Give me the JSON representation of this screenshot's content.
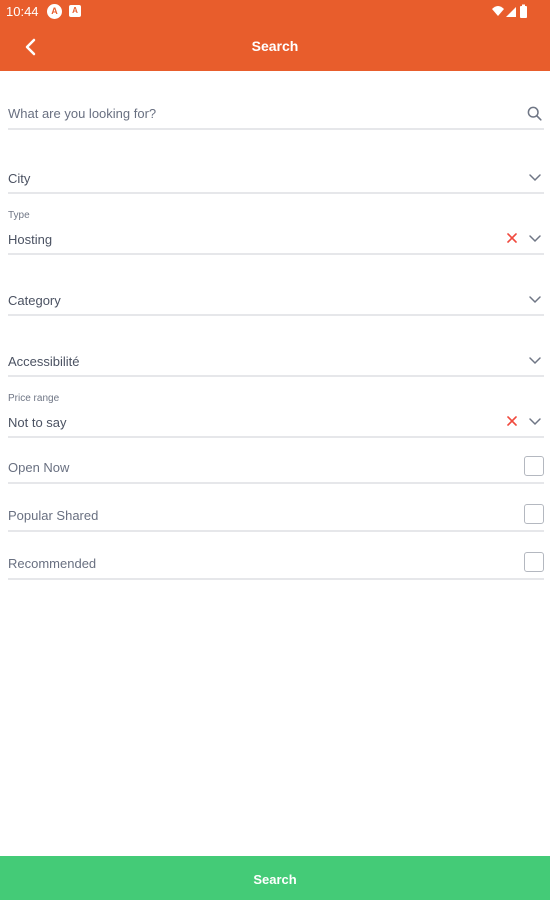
{
  "status_bar": {
    "time": "10:44",
    "icons": [
      "app-notification-icon",
      "app-badge-icon",
      "wifi-icon",
      "signal-icon",
      "battery-icon"
    ]
  },
  "header": {
    "title": "Search",
    "back_icon": "back-arrow-icon",
    "color": "#e85d2c"
  },
  "form": {
    "search": {
      "placeholder": "What are you looking for?",
      "icon": "search-icon"
    },
    "city": {
      "placeholder": "City"
    },
    "type": {
      "label": "Type",
      "value": "Hosting",
      "clear_color": "#f04a3e"
    },
    "category": {
      "placeholder": "Category"
    },
    "accessibility": {
      "placeholder": "Accessibilité"
    },
    "price_range": {
      "label": "Price range",
      "value": "Not to say",
      "clear_color": "#f04a3e"
    },
    "filters": [
      {
        "label": "Open Now",
        "checked": false
      },
      {
        "label": "Popular Shared",
        "checked": false
      },
      {
        "label": "Recommended",
        "checked": false
      }
    ]
  },
  "footer": {
    "search_label": "Search",
    "color": "#44cb77"
  }
}
